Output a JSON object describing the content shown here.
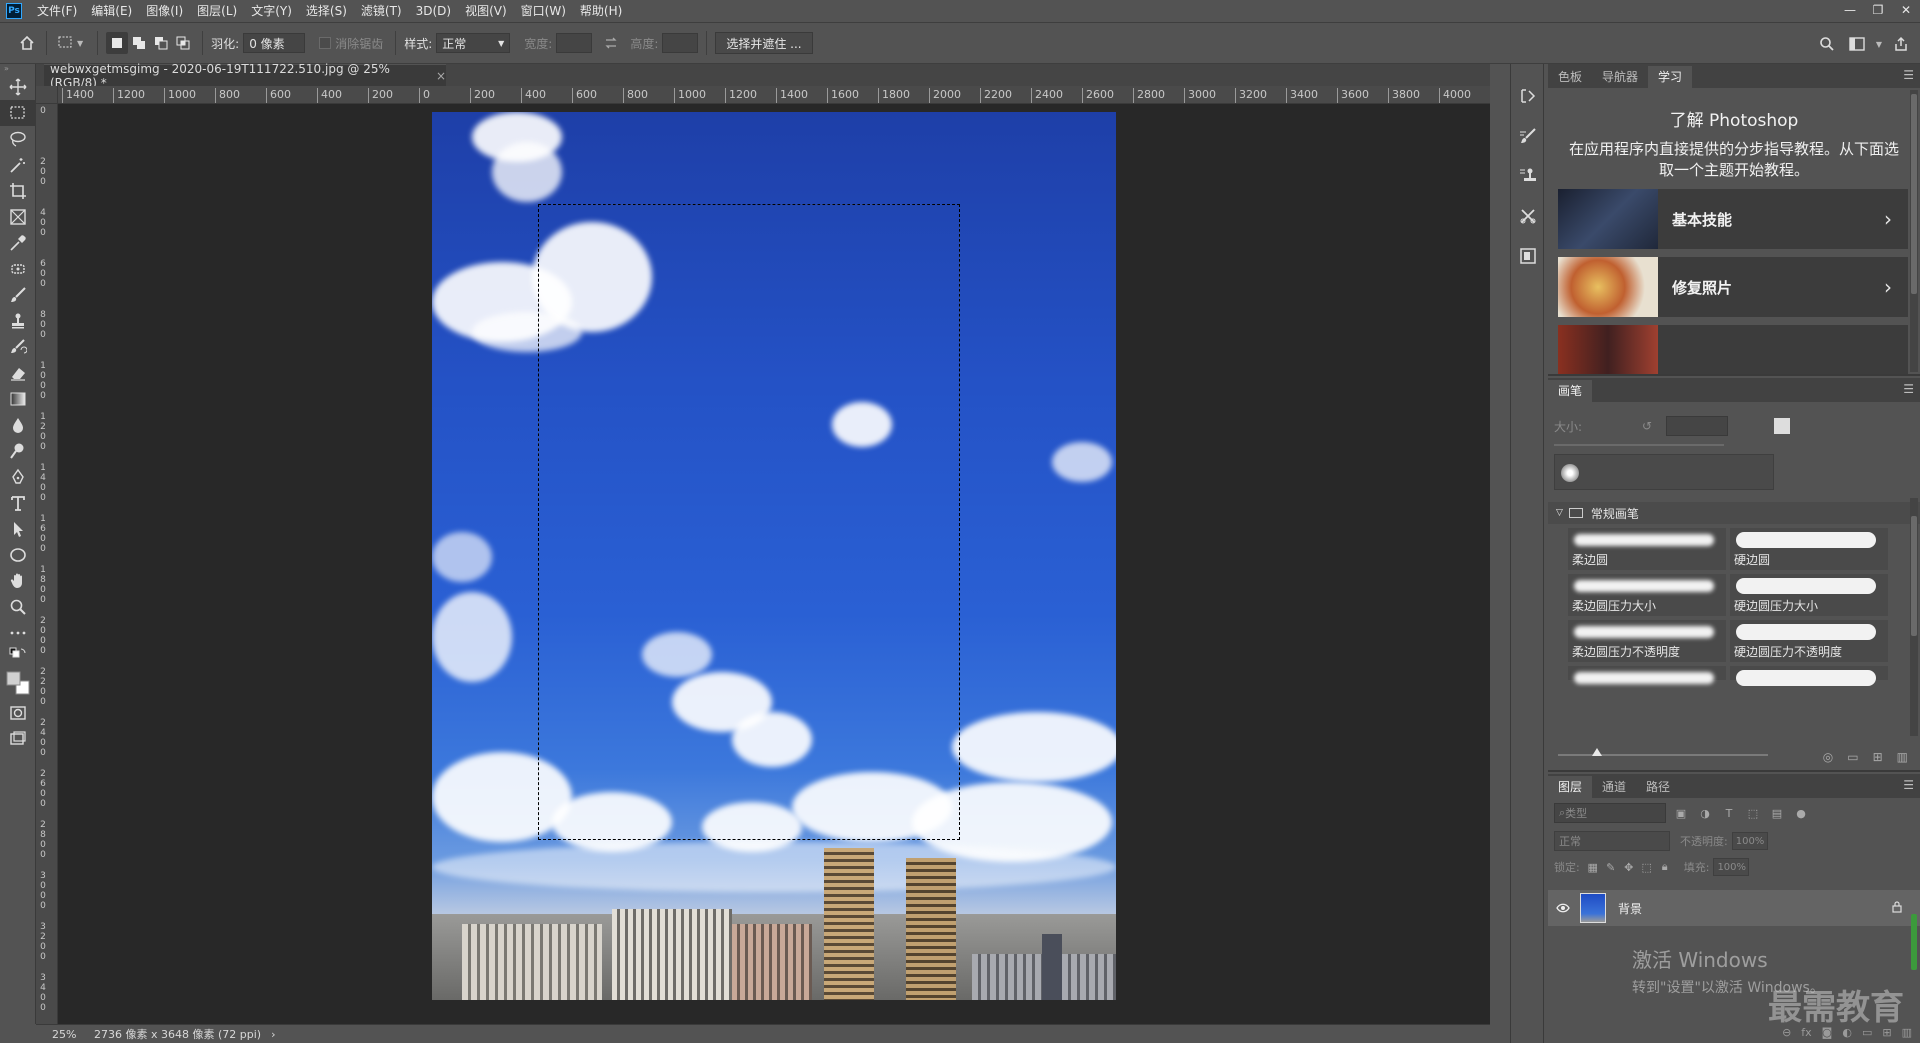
{
  "app": {
    "logo": "Ps",
    "menu": [
      "文件(F)",
      "编辑(E)",
      "图像(I)",
      "图层(L)",
      "文字(Y)",
      "选择(S)",
      "滤镜(T)",
      "3D(D)",
      "视图(V)",
      "窗口(W)",
      "帮助(H)"
    ],
    "window_controls": [
      "—",
      "❐",
      "✕"
    ]
  },
  "options": {
    "feather_label": "羽化:",
    "feather_value": "0 像素",
    "antialias_label": "消除锯齿",
    "style_label": "样式:",
    "style_value": "正常",
    "width_label": "宽度:",
    "height_label": "高度:",
    "select_mask_button": "选择并遮住 ..."
  },
  "document": {
    "tab_title": "webwxgetmsgimg - 2020-06-19T111722.510.jpg @ 25%(RGB/8) *",
    "tab_close": "×",
    "ruler_top_labels": [
      "1400",
      "1200",
      "1000",
      "800",
      "600",
      "400",
      "200",
      "0",
      "200",
      "400",
      "600",
      "800",
      "1000",
      "1200",
      "1400",
      "1600",
      "1800",
      "2000",
      "2200",
      "2400",
      "2600",
      "2800",
      "3000",
      "3200",
      "3400",
      "3600",
      "3800",
      "4000",
      "4"
    ],
    "ruler_left_labels": [
      "0",
      "200",
      "400",
      "600",
      "800",
      "1000",
      "1200",
      "1400",
      "1600",
      "1800",
      "2000",
      "2200",
      "2400",
      "2600",
      "2800",
      "3000",
      "3200",
      "3400"
    ]
  },
  "status": {
    "zoom": "25%",
    "info": "2736 像素 x 3648 像素 (72 ppi)",
    "arrow": "›"
  },
  "learn_panel": {
    "tabs": [
      "色板",
      "导航器",
      "学习"
    ],
    "active_tab": 2,
    "title": "了解 Photoshop",
    "description": "在应用程序内直接提供的分步指导教程。从下面选取一个主题开始教程。",
    "cards": [
      {
        "label": "基本技能"
      },
      {
        "label": "修复照片"
      }
    ]
  },
  "brush_panel": {
    "tab": "画笔",
    "size_label": "大小:",
    "group_name": "常规画笔",
    "brushes": [
      "柔边圆",
      "硬边圆",
      "柔边圆压力大小",
      "硬边圆压力大小",
      "柔边圆压力不透明度",
      "硬边圆压力不透明度"
    ]
  },
  "layers_panel": {
    "tabs": [
      "图层",
      "通道",
      "路径"
    ],
    "active_tab": 0,
    "filter_placeholder": "类型",
    "blend_mode": "正常",
    "opacity_label": "不透明度:",
    "opacity_value": "100%",
    "lock_label": "锁定:",
    "fill_label": "填充:",
    "fill_value": "100%",
    "layers": [
      {
        "name": "背景"
      }
    ]
  },
  "watermark": {
    "activate_title": "激活 Windows",
    "activate_sub": "转到\"设置\"以激活 Windows。",
    "logo_text": "最需教育"
  }
}
